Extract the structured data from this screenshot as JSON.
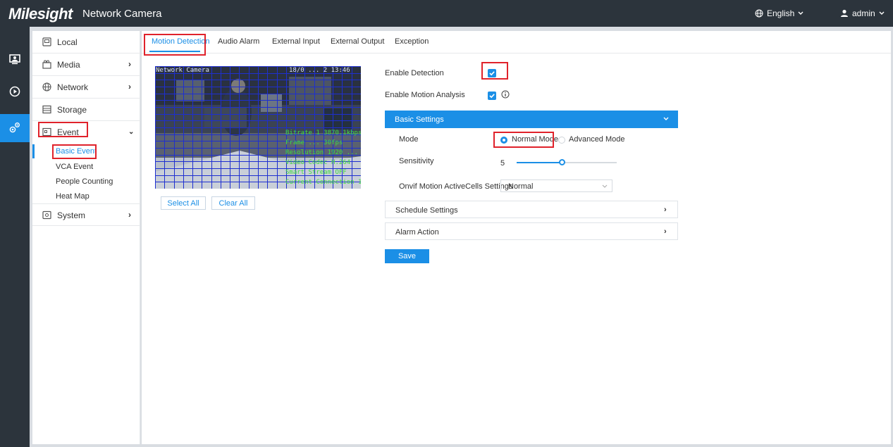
{
  "header": {
    "brand": "Milesight",
    "product": "Network Camera",
    "language": "English",
    "user": "admin"
  },
  "rail": {
    "icons": [
      "live-view-icon",
      "playback-icon",
      "settings-icon"
    ]
  },
  "sidebar": {
    "items": [
      {
        "label": "Local",
        "icon": "local-icon"
      },
      {
        "label": "Media",
        "icon": "media-icon"
      },
      {
        "label": "Network",
        "icon": "network-icon"
      },
      {
        "label": "Storage",
        "icon": "storage-icon"
      },
      {
        "label": "Event",
        "icon": "event-icon"
      },
      {
        "label": "System",
        "icon": "system-icon"
      }
    ],
    "event_sub": [
      "Basic Event",
      "VCA Event",
      "People Counting",
      "Heat Map"
    ]
  },
  "tabs": [
    "Motion Detection",
    "Audio Alarm",
    "External Input",
    "External Output",
    "Exception"
  ],
  "video": {
    "title": "Network Camera",
    "timestamp": "18/0 ... 2 13:46 ",
    "osd_lines": [
      "Bitrate 1 3870.1kbps",
      "Frame ... 30fps",
      "Resolution 1920 ... ",
      "Video Codec H.264",
      "Smart Stream OFF",
      "Current Connection 1"
    ]
  },
  "buttons": {
    "select_all": "Select All",
    "clear_all": "Clear All",
    "save": "Save"
  },
  "settings": {
    "enable_detection_label": "Enable Detection",
    "enable_detection": true,
    "enable_motion_analysis_label": "Enable Motion Analysis",
    "enable_motion_analysis": true,
    "info_icon": "info-icon",
    "basic_settings": "Basic Settings",
    "mode_label": "Mode",
    "mode_normal": "Normal Mode",
    "mode_advanced": "Advanced Mode",
    "mode_selected": "Normal Mode",
    "sensitivity_label": "Sensitivity",
    "sensitivity_value": "5",
    "sensitivity_fraction": 0.45,
    "onvif_label": "Onvif Motion ActiveCells Settings",
    "onvif_value": "Normal",
    "schedule_settings": "Schedule Settings",
    "alarm_action": "Alarm Action"
  },
  "colors": {
    "accent": "#1b8fe6",
    "topbar": "#2c343c",
    "highlight": "#e0222b",
    "grid": "#1e2fd0"
  }
}
